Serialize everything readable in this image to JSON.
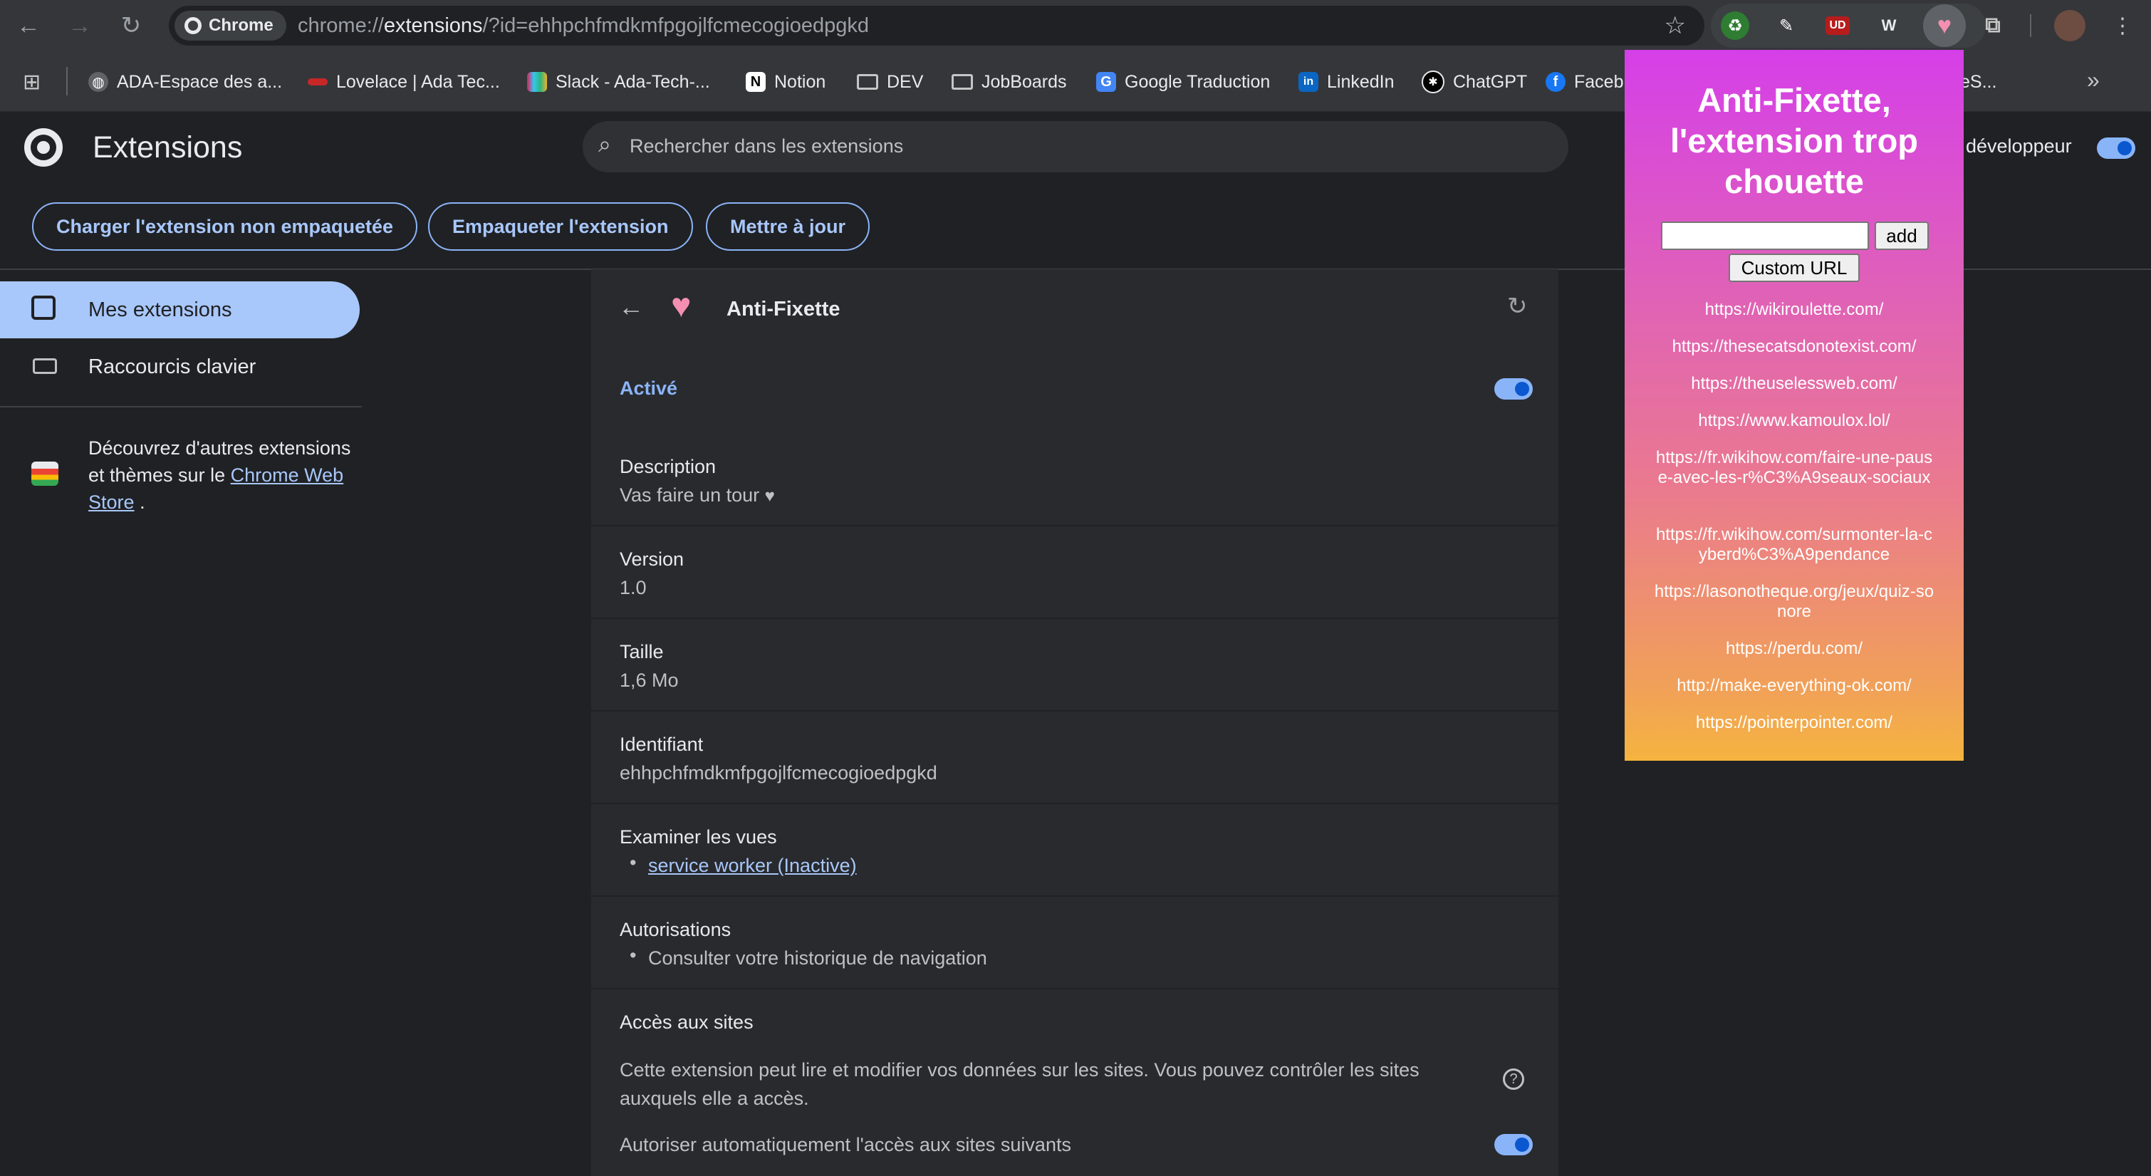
{
  "browser": {
    "chip_label": "Chrome",
    "url_prefix": "chrome://",
    "url_host": "extensions",
    "url_path": "/?id=ehhpchfmdkmfpgojlfcmecogioedpgkd",
    "extension_icons": [
      "extension-green-icon",
      "pipette-icon",
      "ublock-icon",
      "wv-icon",
      "anti-fixette-heart-icon",
      "puzzle-icon"
    ],
    "ext_labels": {
      "ublock": "UD",
      "wv": "W"
    }
  },
  "bookmarks": [
    {
      "label": "ADA-Espace des a...",
      "icon": "globe-icon"
    },
    {
      "label": "Lovelace | Ada Tec...",
      "icon": "lovelace-icon"
    },
    {
      "label": "Slack - Ada-Tech-...",
      "icon": "slack-icon"
    },
    {
      "label": "Notion",
      "icon": "notion-icon",
      "glyph": "N"
    },
    {
      "label": "DEV",
      "icon": "folder-icon"
    },
    {
      "label": "JobBoards",
      "icon": "folder-icon"
    },
    {
      "label": "Google Traduction",
      "icon": "google-translate-icon",
      "glyph": "G"
    },
    {
      "label": "LinkedIn",
      "icon": "linkedin-icon",
      "glyph": "in"
    },
    {
      "label": "ChatGPT",
      "icon": "chatgpt-icon"
    },
    {
      "label": "Faceb",
      "icon": "facebook-icon",
      "glyph": "f"
    },
    {
      "label": "eS...",
      "icon": ""
    }
  ],
  "header": {
    "title": "Extensions",
    "search_placeholder": "Rechercher dans les extensions",
    "dev_mode_label": "développeur",
    "buttons": [
      "Charger l'extension non empaquetée",
      "Empaqueter l'extension",
      "Mettre à jour"
    ]
  },
  "sidebar": {
    "items": [
      {
        "label": "Mes extensions",
        "active": true
      },
      {
        "label": "Raccourcis clavier",
        "active": false
      }
    ],
    "store_text_before": "Découvrez d'autres extensions et thèmes sur le",
    "store_link": "Chrome Web Store",
    "store_text_after": "."
  },
  "details": {
    "name": "Anti-Fixette",
    "enabled_label": "Activé",
    "enabled": true,
    "description_label": "Description",
    "description_value": "Vas faire un tour",
    "version_label": "Version",
    "version_value": "1.0",
    "size_label": "Taille",
    "size_value": "1,6 Mo",
    "id_label": "Identifiant",
    "id_value": "ehhpchfmdkmfpgojlfcmecogioedpgkd",
    "views_label": "Examiner les vues",
    "views_link": "service worker (Inactive)",
    "permissions_label": "Autorisations",
    "permissions_value": "Consulter votre historique de navigation",
    "site_access_label": "Accès aux sites",
    "site_access_text": "Cette extension peut lire et modifier vos données sur les sites. Vous pouvez contrôler les sites auxquels elle a accès.",
    "auto_allow_label": "Autoriser automatiquement l'accès aux sites suivants",
    "auto_allow": true
  },
  "popup": {
    "title": "Anti-Fixette, l'extension trop chouette",
    "input_value": "",
    "add_label": "add",
    "custom_url_label": "Custom URL",
    "links": [
      "https://wikiroulette.com/",
      "https://thesecatsdonotexist.com/",
      "https://theuselessweb.com/",
      "https://www.kamoulox.lol/",
      "https://fr.wikihow.com/faire-une-pause-avec-les-r%C3%A9seaux-sociaux",
      "https://fr.wikihow.com/surmonter-la-cyberd%C3%A9pendance",
      "https://lasonotheque.org/jeux/quiz-sonore",
      "https://perdu.com/",
      "http://make-everything-ok.com/",
      "https://pointerpointer.com/"
    ]
  },
  "colors": {
    "accent": "#8ab4f8",
    "active_nav": "#a8c7fa",
    "panel": "#292a2d",
    "background": "#202124"
  }
}
